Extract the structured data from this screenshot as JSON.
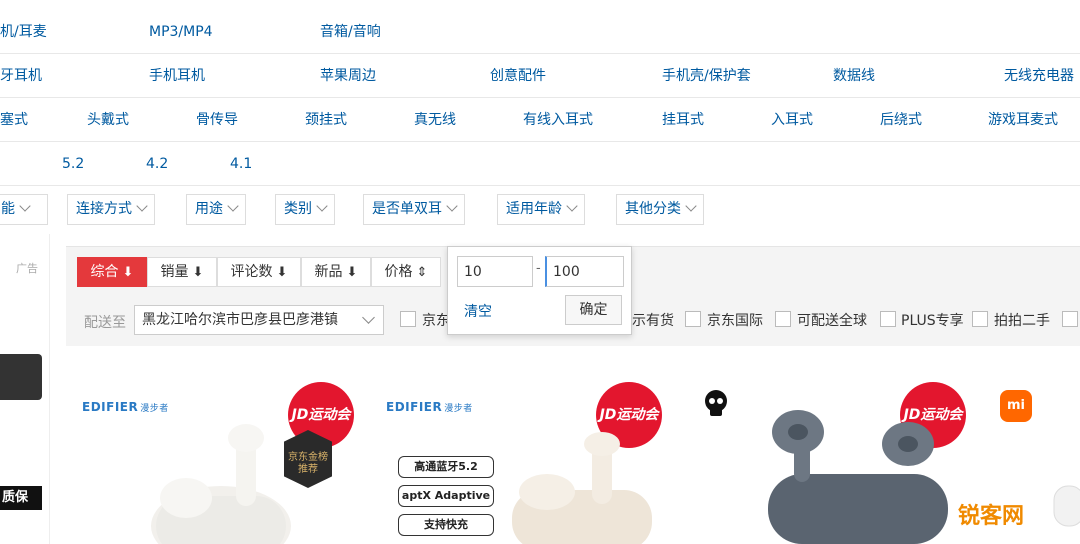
{
  "category_rows": [
    [
      "机/耳麦",
      "MP3/MP4",
      "音箱/音响"
    ],
    [
      "牙耳机",
      "手机耳机",
      "苹果周边",
      "创意配件",
      "手机壳/保护套",
      "数据线",
      "无线充电器"
    ],
    [
      "塞式",
      "头戴式",
      "骨传导",
      "颈挂式",
      "真无线",
      "有线入耳式",
      "挂耳式",
      "入耳式",
      "后绕式",
      "游戏耳麦式"
    ],
    [
      "5.2",
      "4.2",
      "4.1"
    ]
  ],
  "filter_dropdowns": [
    "能",
    "连接方式",
    "用途",
    "类别",
    "是否单双耳",
    "适用年龄",
    "其他分类"
  ],
  "ad_label": "广告",
  "sort_buttons": [
    {
      "label": "综合",
      "arrow": "⬇",
      "active": true
    },
    {
      "label": "销量",
      "arrow": "⬇",
      "active": false
    },
    {
      "label": "评论数",
      "arrow": "⬇",
      "active": false
    },
    {
      "label": "新品",
      "arrow": "⬇",
      "active": false
    },
    {
      "label": "价格",
      "arrow": "⇕",
      "active": false
    }
  ],
  "price_filter": {
    "min": "10",
    "max": "100",
    "dash": "-",
    "clear_label": "清空",
    "confirm_label": "确定"
  },
  "delivery": {
    "label": "配送至",
    "address": "黑龙江哈尔滨市巴彦县巴彦港镇"
  },
  "checkbox_filters": [
    "京东",
    "示有货",
    "京东国际",
    "可配送全球",
    "PLUS专享",
    "拍拍二手"
  ],
  "products": {
    "brands": [
      {
        "name": "EDIFIER",
        "sub": "漫步者"
      },
      {
        "name": "EDIFIER",
        "sub": "漫步者"
      }
    ],
    "promo_badge": "JD运动会",
    "gold_badge": "京东金榜推荐",
    "features": [
      "高通蓝牙5.2",
      "aptX Adaptive",
      "支持快充"
    ],
    "mi_logo": "mi"
  },
  "left_banner": "质保",
  "watermark": "锐客网",
  "colors": {
    "accent_red": "#e4393c",
    "link_blue": "#005aa0",
    "promo_red": "#e3162e"
  }
}
